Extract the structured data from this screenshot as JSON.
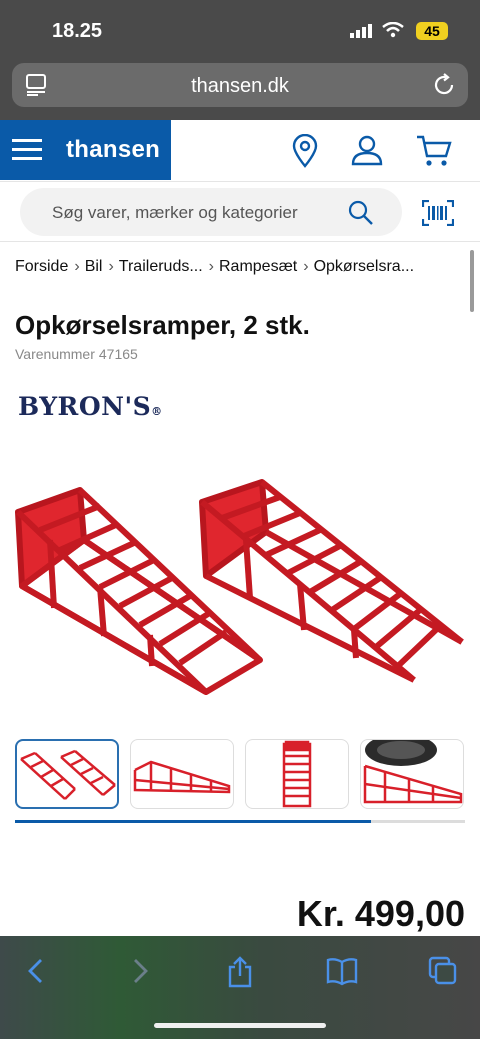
{
  "status": {
    "time": "18.25",
    "battery": "45"
  },
  "browser": {
    "url": "thansen.dk"
  },
  "header": {
    "brand": "thansen"
  },
  "search": {
    "placeholder": "Søg varer, mærker og kategorier"
  },
  "breadcrumb": [
    "Forside",
    "Bil",
    "Traileruds...",
    "Rampesæt",
    "Opkørselsra..."
  ],
  "product": {
    "title": "Opkørselsramper, 2 stk.",
    "sku_label": "Varenummer",
    "sku": "47165",
    "brand": "BYRON'S",
    "price": "Kr. 499,00",
    "gallery_progress": 0.79,
    "thumbnails": [
      "ramps-pair",
      "ramp-side",
      "ramp-top",
      "ramp-with-tire"
    ]
  },
  "colors": {
    "brand_blue": "#0a5aa8",
    "ramp_red": "#d8202a"
  }
}
